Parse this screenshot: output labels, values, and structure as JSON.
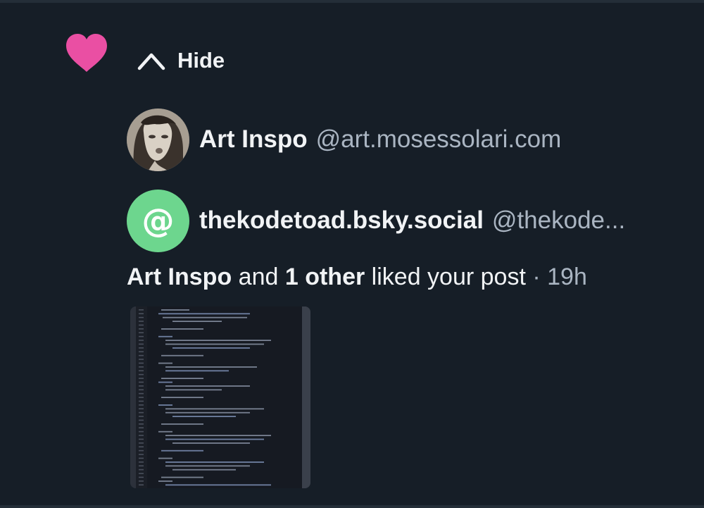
{
  "notification": {
    "icon": "heart-icon",
    "heart_color": "#ea4fa3",
    "hide_icon": "chevron-up-icon",
    "hide_label": "Hide",
    "users": [
      {
        "name": "Art Inspo",
        "handle": "@art.mosessolari.com",
        "avatar": "photo-avatar"
      },
      {
        "name": "thekodetoad.bsky.social",
        "handle": "@thekode...",
        "avatar": "at-sign-avatar",
        "avatar_color": "#6dd68e"
      }
    ],
    "summary": {
      "actor": "Art Inspo",
      "connector": "and",
      "others": "1 other",
      "action": "liked your post",
      "separator": "·",
      "time": "19h"
    },
    "post_preview": {
      "kind": "code-screenshot-thumbnail"
    }
  },
  "colors": {
    "background": "#161e27",
    "text_primary": "#f1f3f5",
    "text_secondary": "#aab5c2"
  }
}
